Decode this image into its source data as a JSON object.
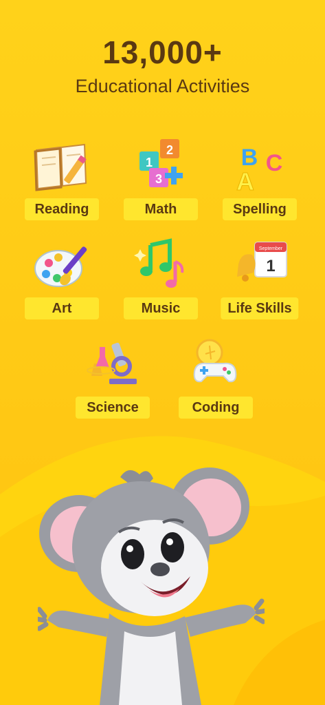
{
  "header": {
    "count": "13,000+",
    "subtitle": "Educational Activities"
  },
  "categories": [
    {
      "label": "Reading",
      "icon": "book-pencil-icon"
    },
    {
      "label": "Math",
      "icon": "number-blocks-icon"
    },
    {
      "label": "Spelling",
      "icon": "abc-letters-icon"
    },
    {
      "label": "Art",
      "icon": "paint-palette-icon"
    },
    {
      "label": "Music",
      "icon": "music-notes-icon"
    },
    {
      "label": "Life Skills",
      "icon": "calendar-bell-icon"
    },
    {
      "label": "Science",
      "icon": "microscope-icon"
    },
    {
      "label": "Coding",
      "icon": "game-controller-icon"
    }
  ],
  "calendar_month": "September",
  "calendar_day": "1",
  "math_digits": [
    "1",
    "2",
    "3"
  ],
  "spelling_letters": [
    "A",
    "B",
    "C"
  ],
  "colors": {
    "background": "#FFD21A",
    "label_bg": "#FFE62E",
    "text": "#5A3912"
  }
}
